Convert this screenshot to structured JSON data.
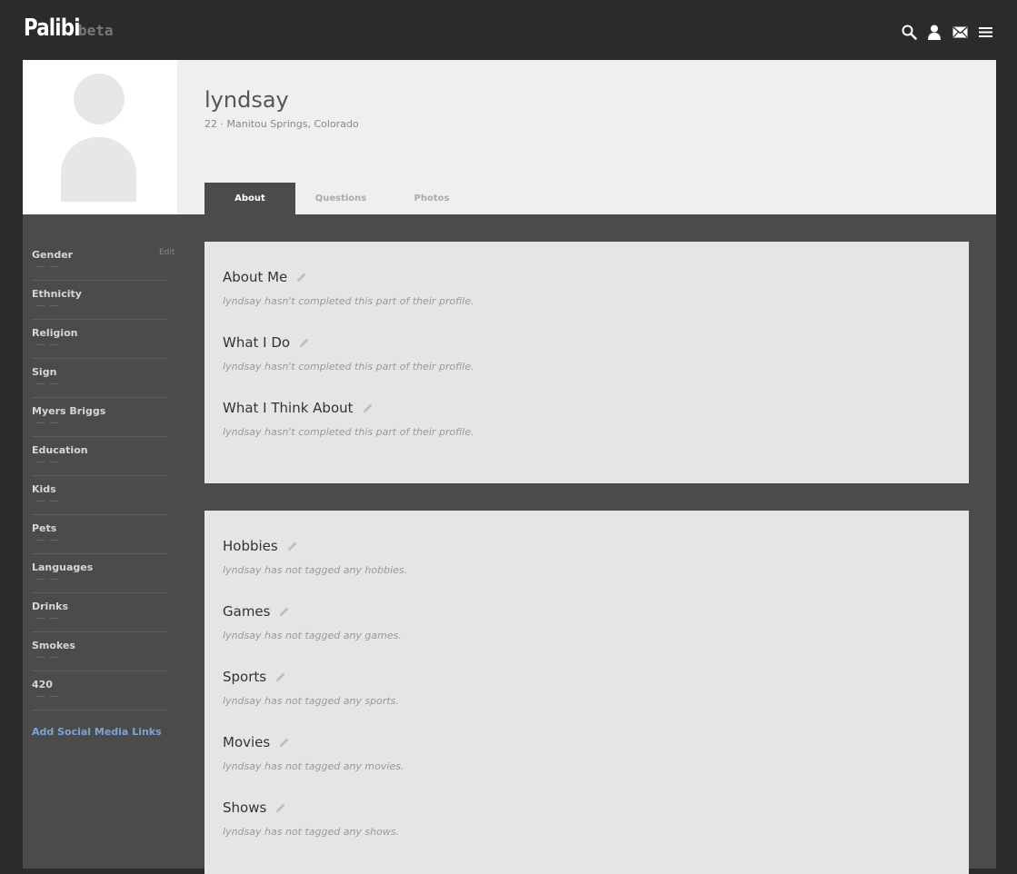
{
  "brand": {
    "name": "Palibi",
    "tag": "beta"
  },
  "nav": {
    "icons": [
      "search-icon",
      "person-icon",
      "mail-icon",
      "menu-icon"
    ]
  },
  "profile": {
    "username": "lyndsay",
    "subinfo": "22 · Manitou Springs, Colorado"
  },
  "tabs": [
    {
      "label": "About",
      "active": true
    },
    {
      "label": "Questions",
      "active": false
    },
    {
      "label": "Photos",
      "active": false
    }
  ],
  "sidebar": {
    "edit_label": "Edit",
    "attributes": [
      {
        "label": "Gender",
        "value": "— —"
      },
      {
        "label": "Ethnicity",
        "value": "— —"
      },
      {
        "label": "Religion",
        "value": "— —"
      },
      {
        "label": "Sign",
        "value": "— —"
      },
      {
        "label": "Myers Briggs",
        "value": "— —"
      },
      {
        "label": "Education",
        "value": "— —"
      },
      {
        "label": "Kids",
        "value": "— —"
      },
      {
        "label": "Pets",
        "value": "— —"
      },
      {
        "label": "Languages",
        "value": "— —"
      },
      {
        "label": "Drinks",
        "value": "— —"
      },
      {
        "label": "Smokes",
        "value": "— —"
      },
      {
        "label": "420",
        "value": "— —"
      }
    ],
    "social_link": "Add Social Media Links"
  },
  "card_about": [
    {
      "title": "About Me",
      "body": "lyndsay hasn't completed this part of their profile."
    },
    {
      "title": "What I Do",
      "body": "lyndsay hasn't completed this part of their profile."
    },
    {
      "title": "What I Think About",
      "body": "lyndsay hasn't completed this part of their profile."
    }
  ],
  "card_interests": [
    {
      "title": "Hobbies",
      "body": "lyndsay has not tagged any hobbies."
    },
    {
      "title": "Games",
      "body": "lyndsay has not tagged any games."
    },
    {
      "title": "Sports",
      "body": "lyndsay has not tagged any sports."
    },
    {
      "title": "Movies",
      "body": "lyndsay has not tagged any movies."
    },
    {
      "title": "Shows",
      "body": "lyndsay has not tagged any shows."
    }
  ],
  "colors": {
    "accent": "#7ba3d4",
    "dark": "#2b2b2b",
    "panel": "#4b4b4b"
  }
}
